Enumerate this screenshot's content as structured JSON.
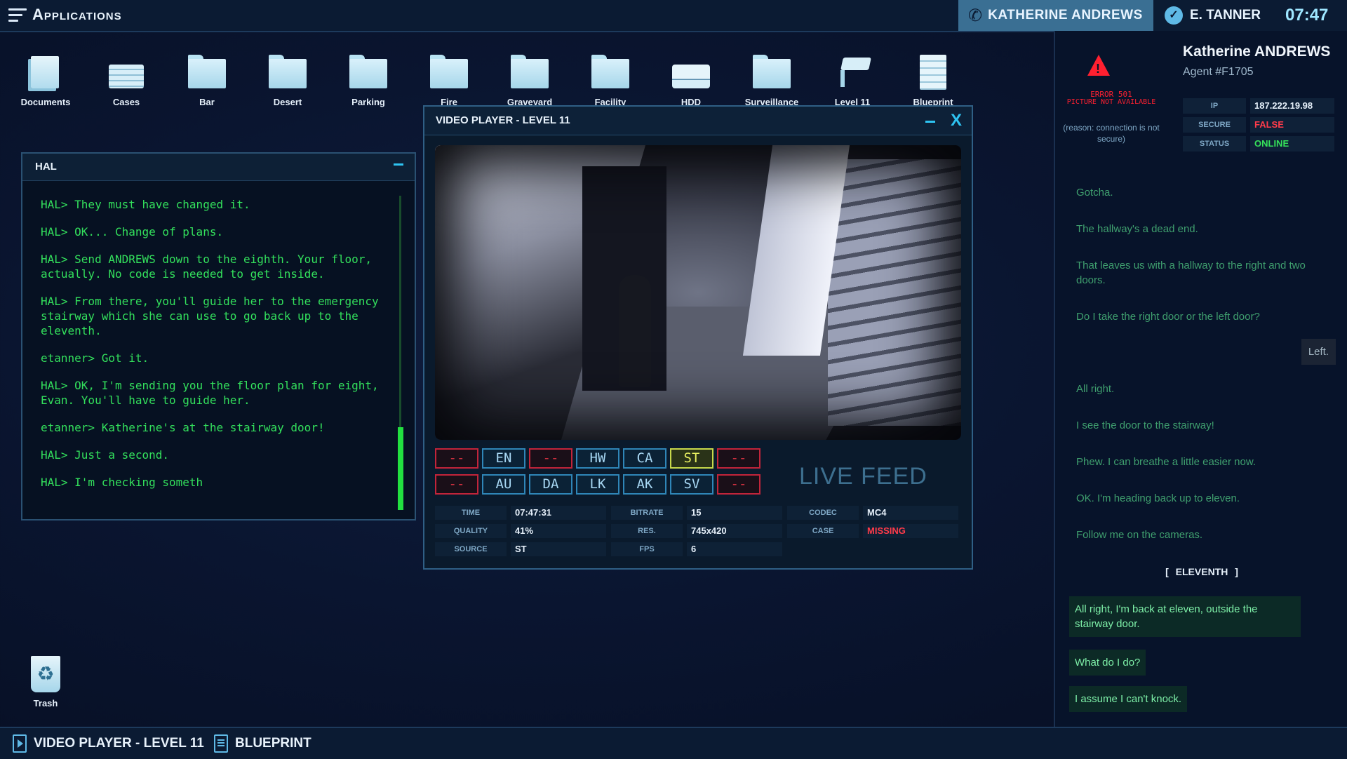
{
  "topbar": {
    "app_title": "Applications",
    "call_name": "KATHERINE ANDREWS",
    "user_name": "E. TANNER",
    "clock": "07:47"
  },
  "desktop_icons": [
    {
      "label": "Documents",
      "icon": "documents-icon"
    },
    {
      "label": "Cases",
      "icon": "cases-icon"
    },
    {
      "label": "Bar",
      "icon": "folder-icon"
    },
    {
      "label": "Desert",
      "icon": "folder-icon"
    },
    {
      "label": "Parking",
      "icon": "folder-icon"
    },
    {
      "label": "Fire",
      "icon": "folder-icon"
    },
    {
      "label": "Graveyard",
      "icon": "folder-icon"
    },
    {
      "label": "Facility",
      "icon": "folder-icon"
    },
    {
      "label": "HDD",
      "icon": "hdd-icon"
    },
    {
      "label": "Surveillance",
      "icon": "folder-icon"
    },
    {
      "label": "Level 11",
      "icon": "camera-icon"
    },
    {
      "label": "Blueprint",
      "icon": "blueprint-icon"
    }
  ],
  "trash": {
    "label": "Trash"
  },
  "hal": {
    "title": "HAL",
    "lines": [
      "HAL> They must have changed it.",
      "HAL> OK... Change of plans.",
      "HAL> Send ANDREWS down to the eighth. Your floor, actually. No code is needed to get inside.",
      "HAL> From there, you'll guide her to the emergency stairway which she can use to go back up to the eleventh.",
      "etanner> Got it.",
      "HAL> OK, I'm sending you the floor plan for eight, Evan. You'll have to guide her.",
      "etanner> Katherine's at the stairway door!",
      "HAL> Just a second.",
      "HAL> I'm checking someth"
    ]
  },
  "video_player": {
    "title": "VIDEO PLAYER - LEVEL 11",
    "cameras_row1": [
      "--",
      "EN",
      "--",
      "HW",
      "CA",
      "ST",
      "--"
    ],
    "cameras_row2": [
      "--",
      "AU",
      "DA",
      "LK",
      "AK",
      "SV",
      "--"
    ],
    "selected_camera": "ST",
    "live_label": "LIVE FEED",
    "info": {
      "time_label": "TIME",
      "time": "07:47:31",
      "quality_label": "QUALITY",
      "quality": "41%",
      "source_label": "SOURCE",
      "source": "ST",
      "bitrate_label": "BITRATE",
      "bitrate": "15",
      "res_label": "RES.",
      "res": "745x420",
      "fps_label": "FPS",
      "fps": "6",
      "codec_label": "CODEC",
      "codec": "MC4",
      "case_label": "CASE",
      "case": "MISSING"
    }
  },
  "profile": {
    "name": "Katherine ANDREWS",
    "agent_id": "Agent #F1705",
    "error_code": "ERROR 501",
    "error_text": "PICTURE NOT AVAILABLE",
    "error_reason": "(reason: connection is not secure)",
    "ip_label": "IP",
    "ip": "187.222.19.98",
    "secure_label": "SECURE",
    "secure": "FALSE",
    "status_label": "STATUS",
    "status": "ONLINE"
  },
  "chat": {
    "messages": [
      {
        "side": "in",
        "text": "Gotcha."
      },
      {
        "side": "in",
        "text": "The hallway's a dead end."
      },
      {
        "side": "in",
        "text": "That leaves us with a hallway to the right and two doors."
      },
      {
        "side": "in",
        "text": "Do I take the right door or the left door?"
      },
      {
        "side": "out",
        "text": "Left."
      },
      {
        "side": "in",
        "text": "All right."
      },
      {
        "side": "in",
        "text": "I see the door to the stairway!"
      },
      {
        "side": "in",
        "text": "Phew. I can breathe a little easier now."
      },
      {
        "side": "in",
        "text": "OK. I'm heading back up to eleven."
      },
      {
        "side": "in",
        "text": "Follow me on the cameras."
      }
    ],
    "separator": "[ ELEVENTH ]",
    "new_messages": [
      {
        "side": "in",
        "text": "All right, I'm back at eleven, outside the stairway door."
      },
      {
        "side": "in",
        "text": "What do I do?"
      },
      {
        "side": "in",
        "text": "I assume I can't knock."
      }
    ]
  },
  "taskbar": {
    "items": [
      "VIDEO PLAYER - LEVEL 11",
      "BLUEPRINT"
    ]
  },
  "colors": {
    "terminal_green": "#33e05c",
    "accent_cyan": "#2ec4f2",
    "alert_red": "#ff2030",
    "online_green": "#36e25a"
  }
}
